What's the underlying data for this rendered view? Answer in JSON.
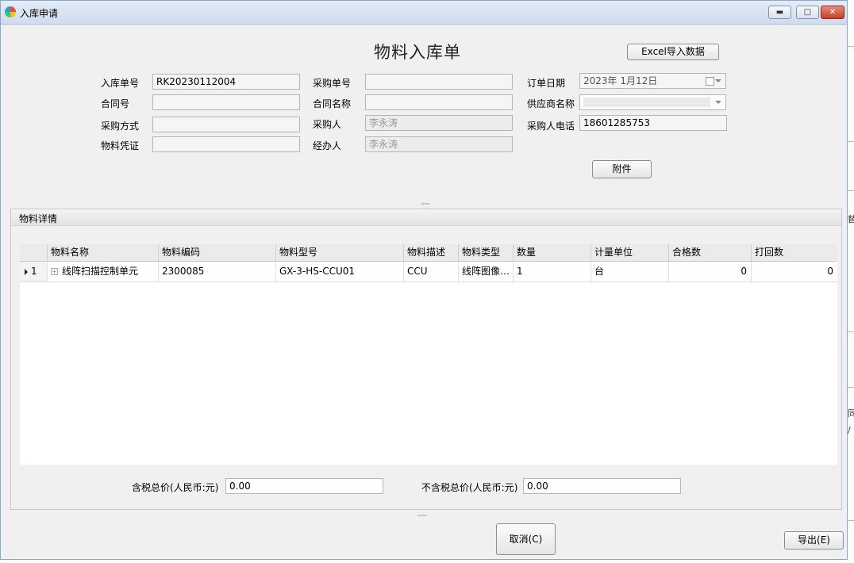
{
  "window": {
    "title": "入库申请"
  },
  "form": {
    "title": "物料入库单",
    "excel_import_button": "Excel导入数据",
    "attachment_button": "附件",
    "fields": {
      "inbound_no_label": "入库单号",
      "inbound_no_value": "RK20230112004",
      "purchase_no_label": "采购单号",
      "purchase_no_value": "",
      "order_date_label": "订单日期",
      "order_date_value": "2023年  1月12日",
      "contract_no_label": "合同号",
      "contract_no_value": "",
      "contract_name_label": "合同名称",
      "contract_name_value": "",
      "supplier_label": "供应商名称",
      "supplier_value": "",
      "purchase_method_label": "采购方式",
      "purchase_method_value": "",
      "purchaser_label": "采购人",
      "purchaser_value": "李永涛",
      "purchaser_phone_label": "采购人电话",
      "purchaser_phone_value": "18601285753",
      "material_voucher_label": "物料凭证",
      "material_voucher_value": "",
      "handler_label": "经办人",
      "handler_value": "李永涛"
    }
  },
  "details": {
    "group_title": "物料详情",
    "columns": [
      "物料名称",
      "物料编码",
      "物料型号",
      "物料描述",
      "物料类型",
      "数量",
      "计量单位",
      "合格数",
      "打回数"
    ],
    "rows": [
      {
        "row_no": "1",
        "expand_glyph": "+",
        "name": "线阵扫描控制单元",
        "code": "2300085",
        "model": "GX-3-HS-CCU01",
        "description": "CCU",
        "type": "线阵图像…",
        "quantity": "1",
        "unit": "台",
        "qualified": "0",
        "rejected": "0"
      }
    ],
    "tax_total_label": "含税总价(人民币:元)",
    "tax_total_value": "0.00",
    "notax_total_label": "不含税总价(人民币:元)",
    "notax_total_value": "0.00"
  },
  "footer": {
    "cancel_button": "取消(C)",
    "export_button": "导出(E)"
  },
  "background_window": {
    "fragments": [
      "替",
      "同",
      "/"
    ]
  }
}
